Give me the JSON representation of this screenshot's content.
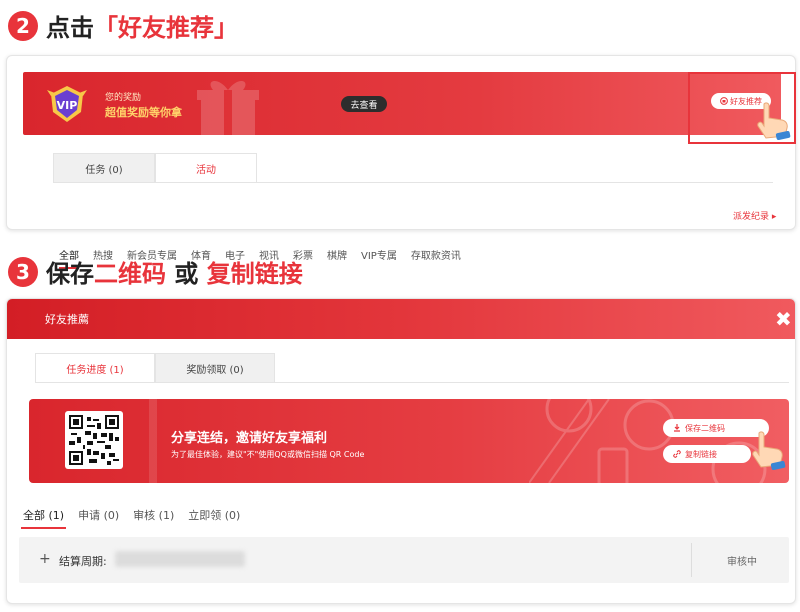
{
  "step2": {
    "number": "2",
    "prefix": "点击",
    "highlight": "「好友推荐」"
  },
  "step3": {
    "number": "3",
    "prefix": "保存 ",
    "part1": "二维码",
    "middle": " 或 ",
    "part2": "复制链接"
  },
  "panel1": {
    "banner": {
      "small_text": "您的奖励",
      "main_text": "超值奖励等你拿",
      "go_button": "去查看",
      "friend_button": "好友推荐",
      "vip_text": "VIP"
    },
    "tabs": [
      {
        "label": "任务 (0)"
      },
      {
        "label": "活动"
      }
    ],
    "dispatch_link": "派发纪录 ▸",
    "categories": [
      "全部",
      "热搜",
      "新会员专属",
      "体育",
      "电子",
      "视讯",
      "彩票",
      "棋牌",
      "VIP专属",
      "存取款资讯"
    ]
  },
  "panel2": {
    "header_title": "好友推薦",
    "close_symbol": "✖",
    "tabs": [
      {
        "label": "任务进度 (1)"
      },
      {
        "label": "奖励领取 (0)"
      }
    ],
    "banner": {
      "main_text": "分享连结，邀请好友享福利",
      "sub_text": "为了最佳体验，建议\"不\"使用QQ或微信扫描 QR Code",
      "save_button": "保存二维码",
      "copy_button": "复制链接"
    },
    "categories": [
      "全部 (1)",
      "申请 (0)",
      "审核 (1)",
      "立即领 (0)"
    ],
    "row": {
      "plus": "+",
      "label": "结算周期:",
      "status": "审核中"
    }
  },
  "colors": {
    "accent": "#e8343b",
    "banner_dark": "#d9262d",
    "banner_light": "#f05a5e"
  }
}
